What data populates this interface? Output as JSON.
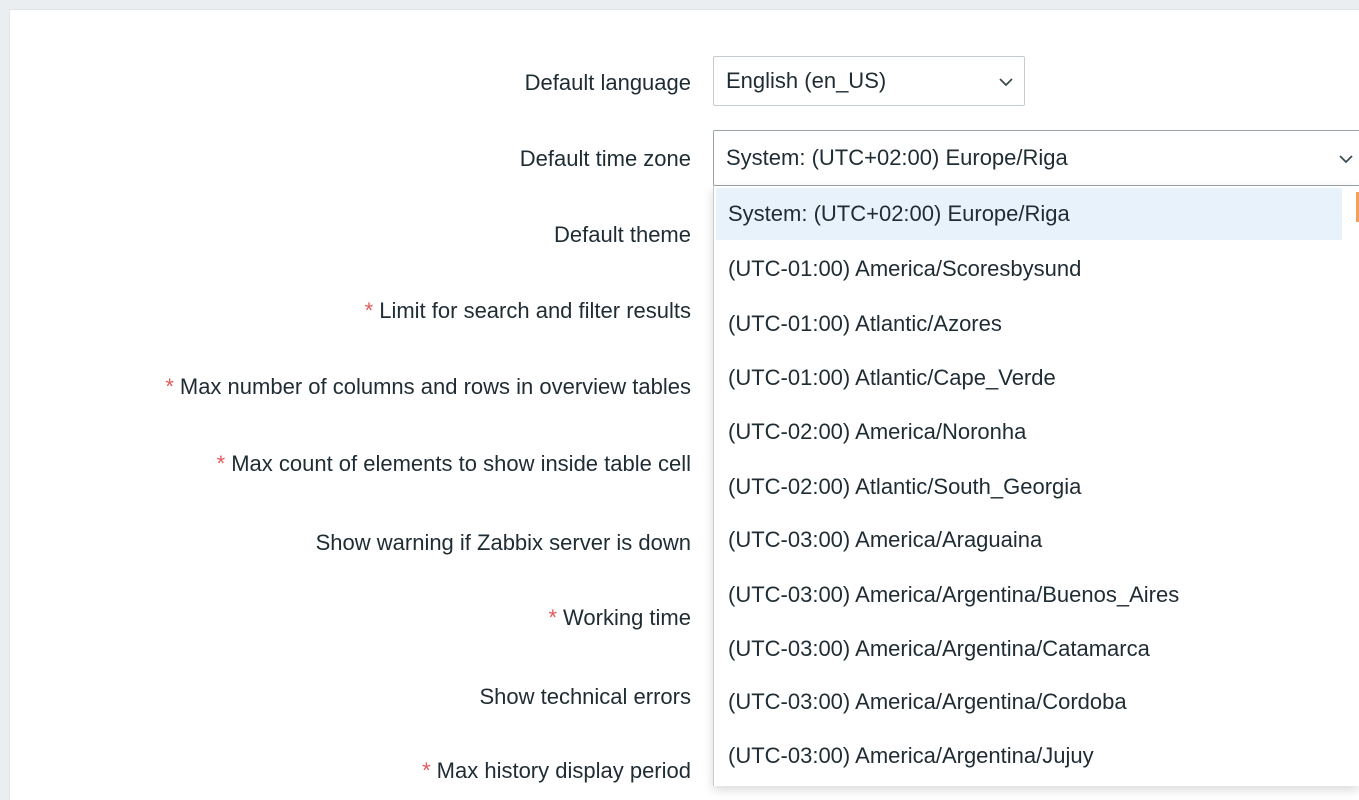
{
  "form": {
    "labels": {
      "default_language": "Default language",
      "default_time_zone": "Default time zone",
      "default_theme": "Default theme",
      "search_limit": "Limit for search and filter results",
      "max_columns_rows": "Max number of columns and rows in overview tables",
      "max_count_elements": "Max count of elements to show inside table cell",
      "show_warning_server_down": "Show warning if Zabbix server is down",
      "working_time": "Working time",
      "show_technical_errors": "Show technical errors",
      "max_history_period": "Max history display period"
    },
    "required_marker": "*",
    "language_select": {
      "value": "English (en_US)"
    },
    "timezone_select": {
      "value": "System: (UTC+02:00) Europe/Riga",
      "options": [
        "System: (UTC+02:00) Europe/Riga",
        "(UTC-01:00) America/Scoresbysund",
        "(UTC-01:00) Atlantic/Azores",
        "(UTC-01:00) Atlantic/Cape_Verde",
        "(UTC-02:00) America/Noronha",
        "(UTC-02:00) Atlantic/South_Georgia",
        "(UTC-03:00) America/Araguaina",
        "(UTC-03:00) America/Argentina/Buenos_Aires",
        "(UTC-03:00) America/Argentina/Catamarca",
        "(UTC-03:00) America/Argentina/Cordoba",
        "(UTC-03:00) America/Argentina/Jujuy"
      ]
    }
  },
  "colors": {
    "required": "#e45959",
    "selected_option_bg": "#e8f2fb",
    "text": "#1f2c33"
  },
  "icons": {
    "select_arrow": "chevron-down-icon"
  }
}
